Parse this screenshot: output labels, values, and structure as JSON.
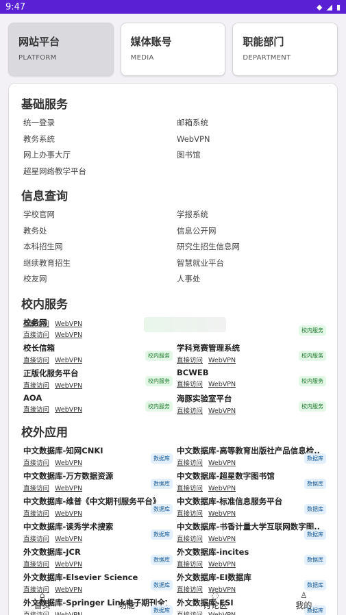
{
  "status": {
    "time": "9:47",
    "icons": [
      "wifi-icon",
      "signal-icon",
      "battery-icon"
    ]
  },
  "tabs": [
    {
      "title": "网站平台",
      "sub": "PLATFORM",
      "active": true
    },
    {
      "title": "媒体账号",
      "sub": "MEDIA",
      "active": false
    },
    {
      "title": "职能部门",
      "sub": "DEPARTMENT",
      "active": false
    }
  ],
  "sections": {
    "basic": {
      "title": "基础服务",
      "items": [
        "统一登录",
        "邮箱系统",
        "教务系统",
        "WebVPN",
        "网上办事大厅",
        "图书馆",
        "超星网络教学平台"
      ]
    },
    "info": {
      "title": "信息查询",
      "items": [
        "学校官网",
        "学报系统",
        "教务处",
        "信息公开网",
        "本科招生网",
        "研究生招生信息网",
        "继续教育招生",
        "智慧就业平台",
        "校友网",
        "人事处"
      ]
    },
    "campus": {
      "title": "校内服务",
      "link_direct": "直接访问",
      "link_vpn": "WebVPN",
      "badge": "校内服务",
      "items": [
        {
          "name": "校务网",
          "badge": false
        },
        {
          "name": "",
          "badge": true
        },
        {
          "name": "校长信箱",
          "badge": true
        },
        {
          "name": "学科竞赛管理系统",
          "badge": true
        },
        {
          "name": "正版化服务平台",
          "badge": true
        },
        {
          "name": "BCWEB",
          "badge": true
        },
        {
          "name": "AOA",
          "badge": true
        },
        {
          "name": "海豚实验室平台",
          "badge": true
        }
      ]
    },
    "external": {
      "title": "校外应用",
      "link_direct": "直接访问",
      "link_vpn": "WebVPN",
      "badge": "数据库",
      "items": [
        {
          "name": "中文数据库-知网CNKI"
        },
        {
          "name": "中文数据库-高等教育出版社产品信息检..."
        },
        {
          "name": "中文数据库-万方数据资源"
        },
        {
          "name": "中文数据库-超星数字图书馆"
        },
        {
          "name": "中文数据库-维普《中文期刊服务平台》"
        },
        {
          "name": "中文数据库-标准信息服务平台"
        },
        {
          "name": "中文数据库-读秀学术搜索"
        },
        {
          "name": "中文数据库-书香计量大学互联网数字图..."
        },
        {
          "name": "外文数据库-JCR"
        },
        {
          "name": "外文数据库-incites"
        },
        {
          "name": "外文数据库-Elsevier Science"
        },
        {
          "name": "外文数据库-EI数据库"
        },
        {
          "name": "外文数据库-Springer Link电子期刊全文..."
        },
        {
          "name": "外文数据库-ESI"
        }
      ]
    }
  },
  "nav": [
    {
      "label": "首页",
      "icon": "home-icon"
    },
    {
      "label": "功能",
      "icon": "apps-icon"
    },
    {
      "label": "讨论区",
      "icon": "chat-icon"
    },
    {
      "label": "我的",
      "icon": "person-icon"
    }
  ]
}
